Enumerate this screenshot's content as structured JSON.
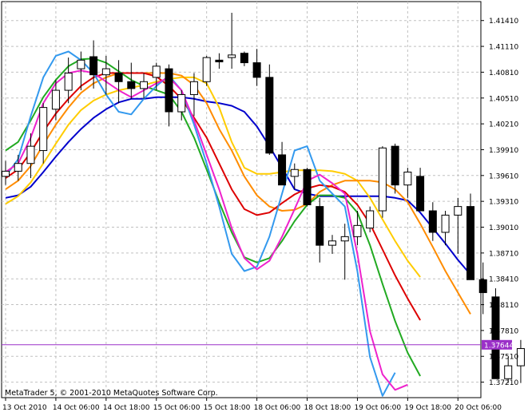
{
  "chart_data": {
    "type": "candlestick",
    "instrument_note": "",
    "watermark": "MetaTrader 5, © 2001-2010 MetaQuotes Software Corp.",
    "current_price_label": "1.37644",
    "current_price": 1.37644,
    "ylim": [
      1.3703,
      1.4163
    ],
    "y_ticks": [
      "1.41410",
      "1.41110",
      "1.40810",
      "1.40510",
      "1.40210",
      "1.39910",
      "1.39610",
      "1.39310",
      "1.39010",
      "1.38710",
      "1.38410",
      "1.38110",
      "1.37810",
      "1.37510",
      "1.37210"
    ],
    "x_ticks": [
      {
        "label": "13 Oct 2010",
        "bar": 0
      },
      {
        "label": "14 Oct 06:00",
        "bar": 4
      },
      {
        "label": "14 Oct 18:00",
        "bar": 8
      },
      {
        "label": "15 Oct 06:00",
        "bar": 12
      },
      {
        "label": "15 Oct 18:00",
        "bar": 16
      },
      {
        "label": "18 Oct 06:00",
        "bar": 20
      },
      {
        "label": "18 Oct 18:00",
        "bar": 24
      },
      {
        "label": "19 Oct 06:00",
        "bar": 28
      },
      {
        "label": "19 Oct 18:00",
        "bar": 32
      },
      {
        "label": "20 Oct 06:00",
        "bar": 36
      }
    ],
    "grid": true,
    "colors": {
      "bull_fill": "#ffffff",
      "bear_fill": "#000000",
      "wick": "#000000",
      "grid": "#c0c0c0",
      "price_line": "#9b30c8",
      "price_label_bg": "#9b30c8"
    },
    "candles": [
      [
        1.396,
        1.3978,
        1.395,
        1.3966
      ],
      [
        1.3966,
        1.3985,
        1.3955,
        1.3975
      ],
      [
        1.3975,
        1.401,
        1.3958,
        1.3995
      ],
      [
        1.399,
        1.4045,
        1.3975,
        1.404
      ],
      [
        1.4038,
        1.4072,
        1.4025,
        1.406
      ],
      [
        1.406,
        1.4098,
        1.4045,
        1.408
      ],
      [
        1.4085,
        1.4105,
        1.406,
        1.4095
      ],
      [
        1.4099,
        1.4118,
        1.4062,
        1.4078
      ],
      [
        1.4078,
        1.41,
        1.4055,
        1.4085
      ],
      [
        1.408,
        1.4095,
        1.4045,
        1.407
      ],
      [
        1.407,
        1.4092,
        1.405,
        1.4062
      ],
      [
        1.4062,
        1.408,
        1.405,
        1.407
      ],
      [
        1.4075,
        1.4092,
        1.406,
        1.4088
      ],
      [
        1.4085,
        1.409,
        1.4018,
        1.4035
      ],
      [
        1.4035,
        1.406,
        1.4025,
        1.4055
      ],
      [
        1.4055,
        1.408,
        1.403,
        1.407
      ],
      [
        1.407,
        1.41,
        1.4065,
        1.4098
      ],
      [
        1.4095,
        1.4103,
        1.4085,
        1.4093
      ],
      [
        1.4098,
        1.415,
        1.4085,
        1.4101
      ],
      [
        1.4103,
        1.4105,
        1.4088,
        1.4092
      ],
      [
        1.4092,
        1.4108,
        1.4065,
        1.4075
      ],
      [
        1.4075,
        1.409,
        1.3985,
        1.3987
      ],
      [
        1.3985,
        1.4,
        1.3955,
        1.395
      ],
      [
        1.396,
        1.3975,
        1.3945,
        1.3968
      ],
      [
        1.3968,
        1.397,
        1.3925,
        1.3927
      ],
      [
        1.3925,
        1.3935,
        1.386,
        1.388
      ],
      [
        1.388,
        1.3892,
        1.387,
        1.3885
      ],
      [
        1.3885,
        1.3905,
        1.384,
        1.389
      ],
      [
        1.389,
        1.392,
        1.388,
        1.3903
      ],
      [
        1.39,
        1.3925,
        1.3895,
        1.392
      ],
      [
        1.392,
        1.3995,
        1.3912,
        1.3993
      ],
      [
        1.3995,
        1.3998,
        1.394,
        1.395
      ],
      [
        1.395,
        1.397,
        1.3935,
        1.3965
      ],
      [
        1.396,
        1.397,
        1.392,
        1.392
      ],
      [
        1.392,
        1.393,
        1.3885,
        1.3895
      ],
      [
        1.3895,
        1.392,
        1.388,
        1.3915
      ],
      [
        1.3915,
        1.3935,
        1.387,
        1.3925
      ],
      [
        1.3925,
        1.394,
        1.385,
        1.384
      ],
      [
        1.384,
        1.386,
        1.38,
        1.3825
      ],
      [
        1.382,
        1.383,
        1.3755,
        1.3725
      ],
      [
        1.3725,
        1.375,
        1.372,
        1.374
      ],
      [
        1.374,
        1.377,
        1.372,
        1.376
      ],
      [
        1.3765,
        1.379,
        1.376,
        1.3764
      ]
    ],
    "series": [
      {
        "color": "#0000cc",
        "values": [
          1.3935,
          1.3938,
          1.3948,
          1.3965,
          1.3983,
          1.4,
          1.4015,
          1.4028,
          1.4038,
          1.4046,
          1.405,
          1.405,
          1.4052,
          1.4052,
          1.4052,
          1.405,
          1.4047,
          1.4045,
          1.4042,
          1.4035,
          1.4018,
          1.3995,
          1.397,
          1.3945,
          1.394,
          1.3937,
          1.3937,
          1.3937,
          1.3937,
          1.3937,
          1.3937,
          1.3935,
          1.3932,
          1.3918,
          1.39,
          1.3882,
          1.3863,
          1.3846
        ]
      },
      {
        "color": "#ffcc00",
        "values": [
          1.3928,
          1.3937,
          1.3953,
          1.3975,
          1.3998,
          1.402,
          1.4037,
          1.4048,
          1.4055,
          1.406,
          1.4063,
          1.4066,
          1.407,
          1.4073,
          1.4075,
          1.4075,
          1.4068,
          1.404,
          1.4,
          1.397,
          1.3963,
          1.3963,
          1.3965,
          1.3967,
          1.3967,
          1.3967,
          1.3966,
          1.3963,
          1.3955,
          1.3935,
          1.391,
          1.3885,
          1.3862,
          1.3843
        ]
      },
      {
        "color": "#ff8c00",
        "values": [
          1.3945,
          1.3955,
          1.3972,
          1.3997,
          1.402,
          1.404,
          1.4057,
          1.4068,
          1.4075,
          1.408,
          1.408,
          1.408,
          1.408,
          1.408,
          1.4077,
          1.4066,
          1.4045,
          1.4015,
          1.399,
          1.396,
          1.3938,
          1.3925,
          1.392,
          1.3921,
          1.3928,
          1.3942,
          1.395,
          1.3955,
          1.3955,
          1.3955,
          1.3953,
          1.3945,
          1.393,
          1.3905,
          1.3878,
          1.385,
          1.3825,
          1.38
        ]
      },
      {
        "color": "#dd0000",
        "values": [
          1.3958,
          1.3968,
          1.3988,
          1.4012,
          1.4033,
          1.405,
          1.4065,
          1.4075,
          1.408,
          1.408,
          1.408,
          1.408,
          1.4076,
          1.4065,
          1.405,
          1.4028,
          1.4005,
          1.3975,
          1.3945,
          1.3922,
          1.3915,
          1.3918,
          1.3929,
          1.3939,
          1.3946,
          1.395,
          1.3948,
          1.3942,
          1.3927,
          1.3905,
          1.3875,
          1.3845,
          1.3818,
          1.3793
        ]
      },
      {
        "color": "#22aa22",
        "values": [
          1.399,
          1.4,
          1.4025,
          1.4052,
          1.4072,
          1.4088,
          1.4096,
          1.4097,
          1.4092,
          1.4082,
          1.4072,
          1.4065,
          1.406,
          1.4055,
          1.4035,
          1.4005,
          1.3968,
          1.393,
          1.3895,
          1.3866,
          1.386,
          1.3865,
          1.3885,
          1.3908,
          1.3927,
          1.3938,
          1.3938,
          1.3935,
          1.3918,
          1.388,
          1.3835,
          1.3792,
          1.3755,
          1.3728
        ]
      },
      {
        "color": "#3399ee",
        "values": [
          1.396,
          1.398,
          1.403,
          1.4075,
          1.41,
          1.4105,
          1.4095,
          1.408,
          1.4055,
          1.4035,
          1.4032,
          1.405,
          1.4065,
          1.4077,
          1.406,
          1.402,
          1.3975,
          1.3925,
          1.387,
          1.385,
          1.3855,
          1.389,
          1.394,
          1.399,
          1.3995,
          1.3955,
          1.394,
          1.3925,
          1.385,
          1.375,
          1.3705,
          1.3732
        ]
      },
      {
        "color": "#ee22cc",
        "values": [
          1.3965,
          1.3975,
          1.4005,
          1.4045,
          1.4068,
          1.408,
          1.4083,
          1.408,
          1.407,
          1.406,
          1.4052,
          1.406,
          1.4068,
          1.4075,
          1.406,
          1.4025,
          1.3985,
          1.3945,
          1.39,
          1.3865,
          1.3852,
          1.3862,
          1.389,
          1.3922,
          1.3955,
          1.3962,
          1.3952,
          1.394,
          1.387,
          1.378,
          1.373,
          1.3712,
          1.3718
        ]
      }
    ]
  }
}
